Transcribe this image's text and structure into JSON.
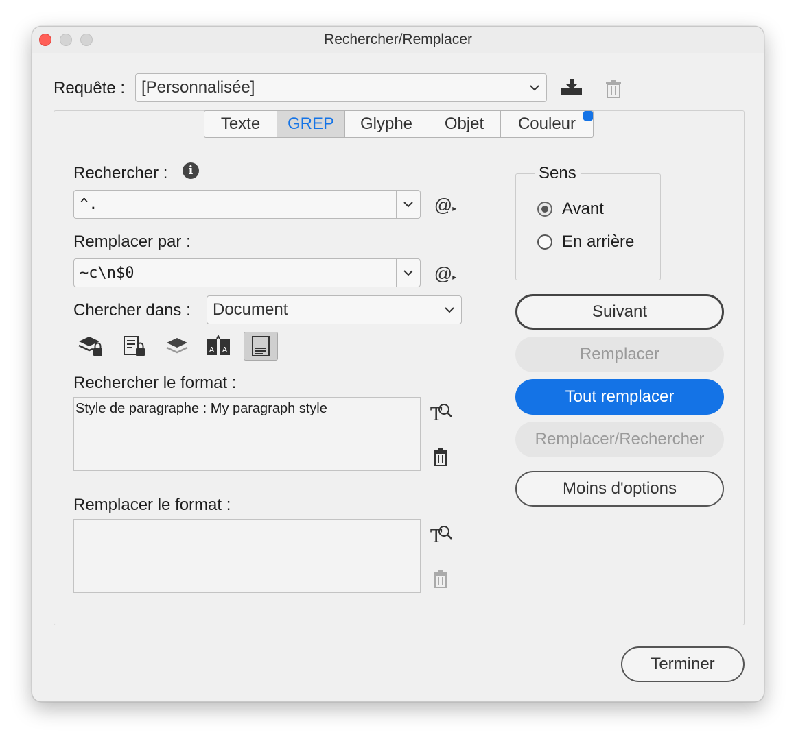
{
  "window": {
    "title": "Rechercher/Remplacer"
  },
  "query": {
    "label": "Requête :",
    "value": "[Personnalisée]"
  },
  "tabs": [
    {
      "label": "Texte"
    },
    {
      "label": "GREP"
    },
    {
      "label": "Glyphe"
    },
    {
      "label": "Objet"
    },
    {
      "label": "Couleur"
    }
  ],
  "find": {
    "label": "Rechercher :",
    "value": "^."
  },
  "replace": {
    "label": "Remplacer par :",
    "value": "~c\\n$0"
  },
  "search_in": {
    "label": "Chercher dans :",
    "value": "Document"
  },
  "find_format": {
    "label": "Rechercher le format :",
    "value": "Style de paragraphe : My paragraph style"
  },
  "replace_format": {
    "label": "Remplacer le format :",
    "value": ""
  },
  "direction": {
    "legend": "Sens",
    "options": [
      {
        "label": "Avant",
        "selected": true
      },
      {
        "label": "En arrière",
        "selected": false
      }
    ]
  },
  "buttons": {
    "next": "Suivant",
    "replace": "Remplacer",
    "replace_all": "Tout remplacer",
    "replace_find": "Remplacer/Rechercher",
    "fewer_options": "Moins d'options",
    "done": "Terminer"
  },
  "colors": {
    "accent": "#1473e6",
    "close": "#ff5f57"
  }
}
